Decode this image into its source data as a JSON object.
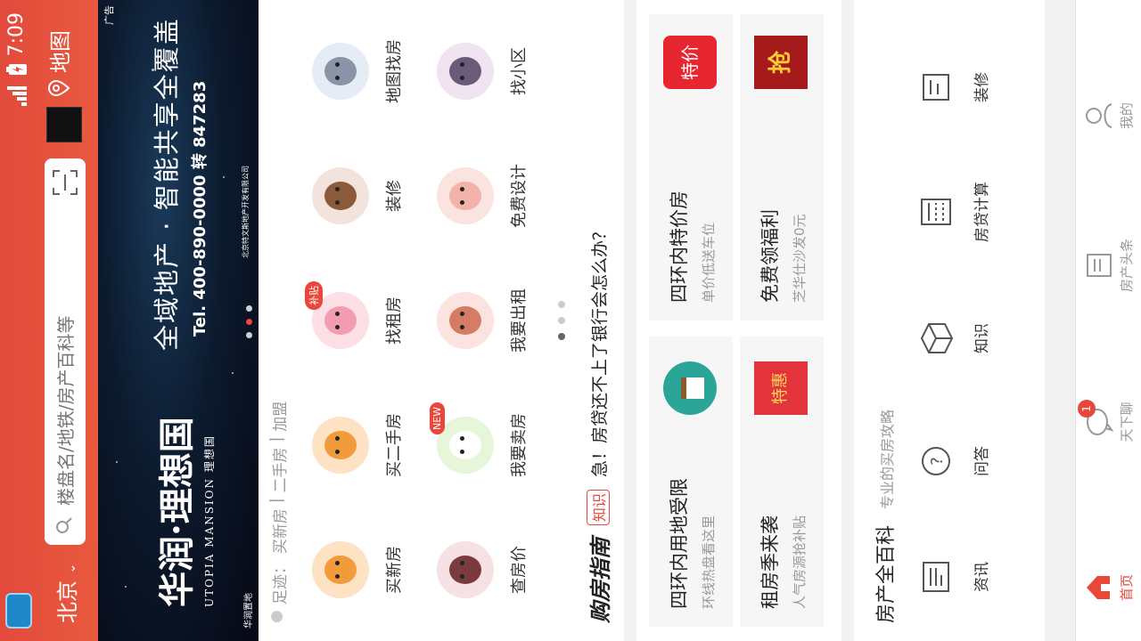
{
  "statusbar": {
    "time": "7:09",
    "left_icon": "app-icon",
    "signal": "signal-icon",
    "battery": "battery-charging-icon"
  },
  "header": {
    "city": "北京",
    "search_placeholder": "楼盘名/地铁/房产百科等",
    "map_label": "地图"
  },
  "banner": {
    "ad_tag": "广告",
    "logo_text": "华润·理想国",
    "logo_sub": "UTOPIA MANSION 理想国",
    "slogan": "全域地产 · 智能共享全覆盖",
    "tel": "Tel. 400-890-0000 转 847283",
    "brand": "华润置地",
    "legal": "北京特文斯地产开发有限公司"
  },
  "trail": {
    "prefix": "足迹：",
    "items": [
      "买新房",
      "二手房",
      "加盟"
    ]
  },
  "nav": [
    {
      "label": "买新房",
      "icon": "tiger-icon"
    },
    {
      "label": "买二手房",
      "icon": "tiger-icon"
    },
    {
      "label": "找租房",
      "icon": "pig-icon",
      "tag": "补贴"
    },
    {
      "label": "装修",
      "icon": "ox-icon"
    },
    {
      "label": "地图找房",
      "icon": "mouse-icon"
    },
    {
      "label": "查房价",
      "icon": "horse-icon"
    },
    {
      "label": "我要卖房",
      "icon": "rabbit-icon",
      "tag": "NEW"
    },
    {
      "label": "我要出租",
      "icon": "dog-icon"
    },
    {
      "label": "免费设计",
      "icon": "sheep-icon"
    },
    {
      "label": "找小区",
      "icon": "snake-icon"
    }
  ],
  "guide": {
    "title": "购房指南",
    "tag": "知识",
    "question": "急！房贷还不上了银行会怎么办？"
  },
  "promo": [
    {
      "title": "四环内用地受限",
      "sub": "环线热盘看这里"
    },
    {
      "title": "四环内特价房",
      "sub": "单价低送车位",
      "badge": "特价"
    },
    {
      "title": "租房季来袭",
      "sub": "人气房源抢补贴",
      "badge": "特惠"
    },
    {
      "title": "免费领福利",
      "sub": "芝华仕沙发0元",
      "badge": "抢"
    }
  ],
  "wiki": {
    "title": "房产全百科",
    "subtitle": "专业的买房攻略",
    "items": [
      {
        "label": "资讯",
        "icon": "news-icon"
      },
      {
        "label": "问答",
        "icon": "question-icon"
      },
      {
        "label": "知识",
        "icon": "box-icon"
      },
      {
        "label": "房贷计算",
        "icon": "calculator-icon"
      },
      {
        "label": "装修",
        "icon": "decor-icon"
      }
    ]
  },
  "tabbar": [
    {
      "label": "首页",
      "icon": "home-icon",
      "active": true
    },
    {
      "label": "天下聊",
      "icon": "chat-icon",
      "badge": "1"
    },
    {
      "label": "房产头条",
      "icon": "headline-icon"
    },
    {
      "label": "我的",
      "icon": "profile-icon"
    }
  ]
}
